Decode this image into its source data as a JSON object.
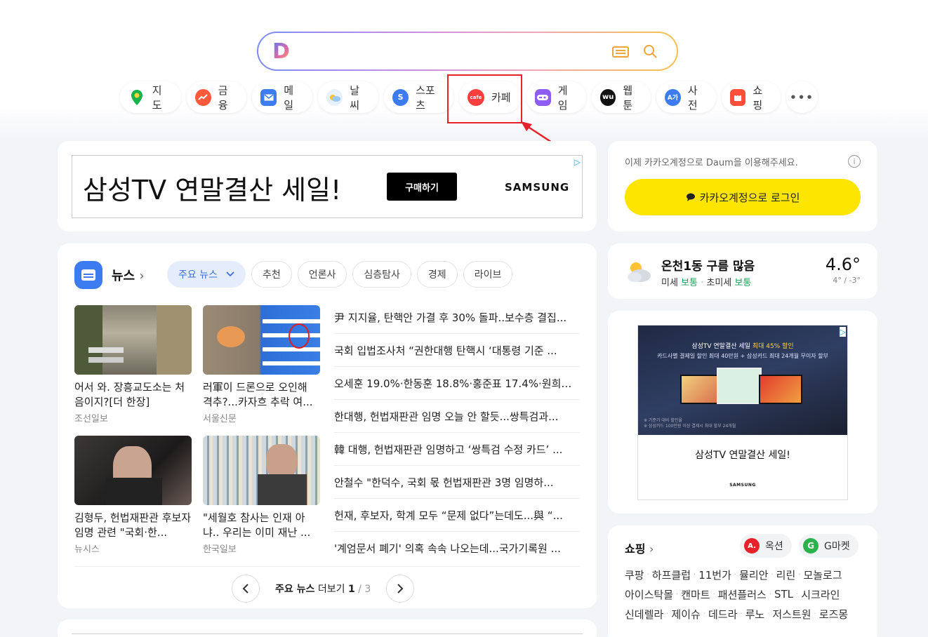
{
  "shortcuts": [
    {
      "label": "지도",
      "icon": "map-pin-icon",
      "color": "#00c73c"
    },
    {
      "label": "금융",
      "icon": "finance-chart-icon",
      "color": "#ff5a3c"
    },
    {
      "label": "메일",
      "icon": "mail-icon",
      "color": "#3d7bf0"
    },
    {
      "label": "날씨",
      "icon": "weather-cloud-icon",
      "color": "#4aa3f2"
    },
    {
      "label": "스포츠",
      "icon": "sports-icon",
      "color": "#3d7bf0"
    },
    {
      "label": "카페",
      "icon": "cafe-icon",
      "color": "#ff3d3d"
    },
    {
      "label": "게임",
      "icon": "game-controller-icon",
      "color": "#8f5cf6"
    },
    {
      "label": "웹툰",
      "icon": "webtoon-icon",
      "color": "#111111"
    },
    {
      "label": "사전",
      "icon": "dictionary-icon",
      "color": "#3d7bf0"
    },
    {
      "label": "쇼핑",
      "icon": "shopping-bag-icon",
      "color": "#ff4e3a"
    }
  ],
  "shortcut_more": "•••",
  "ad_top": {
    "title": "삼성TV 연말결산 세일!",
    "button": "구매하기",
    "brand": "SAMSUNG"
  },
  "login": {
    "notice": "이제 카카오계정으로 Daum을 이용해주세요.",
    "button": "카카오계정으로 로그인"
  },
  "weather": {
    "location": "온천1동 구름 많음",
    "fine_dust_label": "미세",
    "fine_dust_status": "보통",
    "ultra_fine_label": "초미세",
    "ultra_fine_status": "보통",
    "temp": "4.6°",
    "range": "4° / -3°"
  },
  "news": {
    "title": "뉴스",
    "tabs": [
      "주요 뉴스",
      "추천",
      "언론사",
      "심층탐사",
      "경제",
      "라이브"
    ],
    "photo_items": [
      {
        "caption": "어서 와. 장흥교도소는 처음이지?[더 한장]",
        "source": "조선일보"
      },
      {
        "caption": "러軍이 드론으로 오인해 격추?...카자흐 추락 여...",
        "source": "서울신문"
      },
      {
        "caption": "김형두, 헌법재판관 후보자 임명 관련 \"국회·한...",
        "source": "뉴시스"
      },
      {
        "caption": "\"세월호 참사는 인재 아냐.. 우리는 이미 재난 ...",
        "source": "한국일보"
      }
    ],
    "headlines": [
      "尹 지지율, 탄핵안 가결 후 30% 돌파..보수층 결집...",
      "국회 입법조사처 “권한대행 탄핵시 ‘대통령 기준 ...",
      "오세훈 19.0%·한동훈 18.8%·홍준표 17.4%·원희룡 ...",
      "한대행, 헌법재판관 임명 오늘 안 할듯...쌍특검과...",
      "韓 대행, 헌법재판관 임명하고 ‘쌍특검 수정 카드’ ...",
      "안철수 \"한덕수, 국회 몫 헌법재판관 3명 임명하...",
      "헌재, 후보자, 학계 모두 “문제 없다”는데도...與 “...",
      "'계엄문서 폐기' 의혹 속속 나오는데...국가기록원 ..."
    ],
    "pager": {
      "label": "주요 뉴스",
      "more": "더보기",
      "current": "1",
      "total": "3"
    }
  },
  "ad_side": {
    "headline_prefix": "삼성TV 연말결산 세일",
    "headline_highlight": "최대 45% 할인",
    "subline": "카드사별 결제일 할인 최대 40만원 + 삼성카드 최대 24개월 무이자 할부",
    "fine_print_1": "※ 기준가 대비 할인율",
    "fine_print_2": "※ 삼성카드 100만원 이상 결제시 최대 할부 24개월",
    "title": "삼성TV 연말결산 세일!",
    "brand": "SAMSUNG"
  },
  "shopping": {
    "title": "쇼핑",
    "chips": [
      {
        "label": "옥션",
        "mark": "A.",
        "color": "#e8222b"
      },
      {
        "label": "G마켓",
        "mark": "G",
        "color": "#2bb24c"
      }
    ],
    "rows": [
      [
        "쿠팡",
        "하프클럽",
        "11번가",
        "뮬리안",
        "리린",
        "모놀로그"
      ],
      [
        "아이스탁몰",
        "캔마트",
        "패션플러스",
        "STL",
        "시크라인"
      ],
      [
        "신데렐라",
        "제이슈",
        "데드라",
        "루노",
        "저스트원",
        "로즈몽"
      ]
    ]
  },
  "colors": {
    "accent_blue": "#3d7bf0",
    "kakao_yellow": "#fee500",
    "highlight_red": "#e8222b",
    "good_green": "#1da05a"
  }
}
